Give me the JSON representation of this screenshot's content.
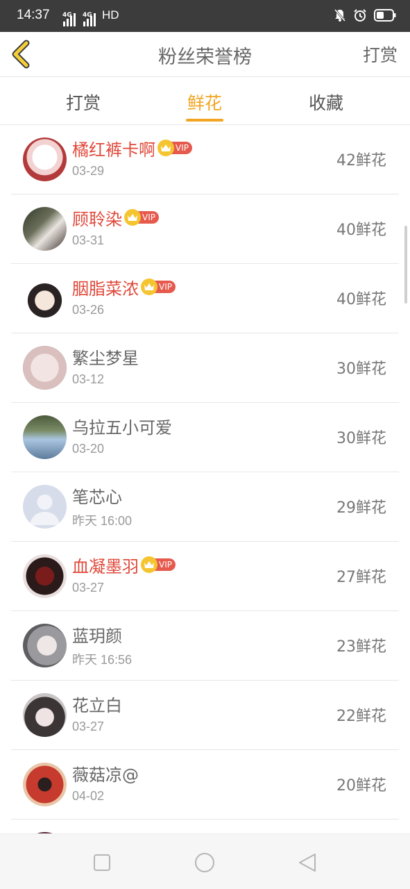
{
  "status_bar": {
    "time": "14:37",
    "net1": "4G",
    "net2": "4G",
    "hd": "HD"
  },
  "header": {
    "title": "粉丝荣誉榜",
    "action": "打赏"
  },
  "tabs": [
    {
      "label": "打赏"
    },
    {
      "label": "鲜花"
    },
    {
      "label": "收藏"
    }
  ],
  "active_tab": "鲜花",
  "vip_label": "VIP",
  "fans": [
    {
      "name": "橘红裤卡啊",
      "date": "03-29",
      "count": "42鲜花",
      "vip": true
    },
    {
      "name": "顾聆染",
      "date": "03-31",
      "count": "40鲜花",
      "vip": true
    },
    {
      "name": "胭脂菜浓",
      "date": "03-26",
      "count": "40鲜花",
      "vip": true
    },
    {
      "name": "繁尘梦星",
      "date": "03-12",
      "count": "30鲜花",
      "vip": false
    },
    {
      "name": "乌拉五小可爱",
      "date": "03-20",
      "count": "30鲜花",
      "vip": false
    },
    {
      "name": "笔芯心",
      "date": "昨天 16:00",
      "count": "29鲜花",
      "vip": false
    },
    {
      "name": "血凝墨羽",
      "date": "03-27",
      "count": "27鲜花",
      "vip": true
    },
    {
      "name": "蓝玥颜",
      "date": "昨天 16:56",
      "count": "23鲜花",
      "vip": false
    },
    {
      "name": "花立白",
      "date": "03-27",
      "count": "22鲜花",
      "vip": false
    },
    {
      "name": "薇菇凉@",
      "date": "04-02",
      "count": "20鲜花",
      "vip": false
    }
  ],
  "colors": {
    "accent": "#f2a520",
    "vip_name": "#e0483a",
    "vip_tag": "#e65a4e"
  }
}
